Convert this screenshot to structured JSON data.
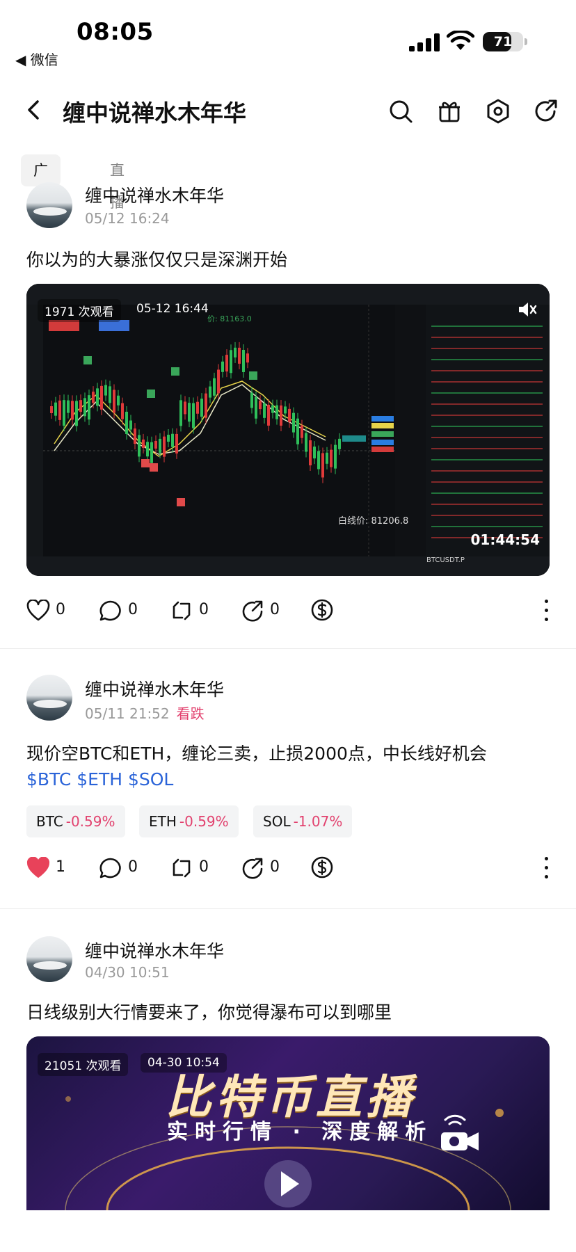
{
  "status": {
    "time": "08:05",
    "back_app": "◀ 微信",
    "battery": "71",
    "battery_level": 0.71
  },
  "nav": {
    "title": "缠中说禅水木年华"
  },
  "tabs": [
    {
      "label": "广场",
      "active": true
    },
    {
      "label": "直播",
      "active": false
    }
  ],
  "posts": [
    {
      "author": "缠中说禅水木年华",
      "time": "05/12 16:24",
      "text": "你以为的大暴涨仅仅只是深渊开始",
      "media": {
        "views": "1971 次观看",
        "date": "05-12 16:44",
        "duration": "01:44:54",
        "white_line_price": "白线价: 81206.8",
        "symbol": "BTCUSDT.P",
        "peak_label": "价: 81163.0"
      },
      "likes": "0",
      "comments": "0",
      "reposts": "0",
      "shares": "0"
    },
    {
      "author": "缠中说禅水木年华",
      "time": "05/11 21:52",
      "tag": "看跌",
      "text": "现价空BTC和ETH，缠论三卖，止损2000点，中长线好机会",
      "tickers": "$BTC $ETH $SOL",
      "coins": [
        {
          "name": "BTC",
          "change": "-0.59%"
        },
        {
          "name": "ETH",
          "change": "-0.59%"
        },
        {
          "name": "SOL",
          "change": "-1.07%"
        }
      ],
      "likes": "1",
      "comments": "0",
      "reposts": "0",
      "shares": "0",
      "liked": true
    },
    {
      "author": "缠中说禅水木年华",
      "time": "04/30 10:51",
      "text": "日线级别大行情要来了，你觉得瀑布可以到哪里",
      "media": {
        "views": "21051 次观看",
        "date": "04-30 10:54",
        "banner_title": "比特币直播",
        "banner_subtitle": "实时行情 · 深度解析"
      }
    }
  ],
  "colors": {
    "accent_red": "#e2416e",
    "ticker_blue": "#2a63d8",
    "like_red": "#e8425a"
  }
}
